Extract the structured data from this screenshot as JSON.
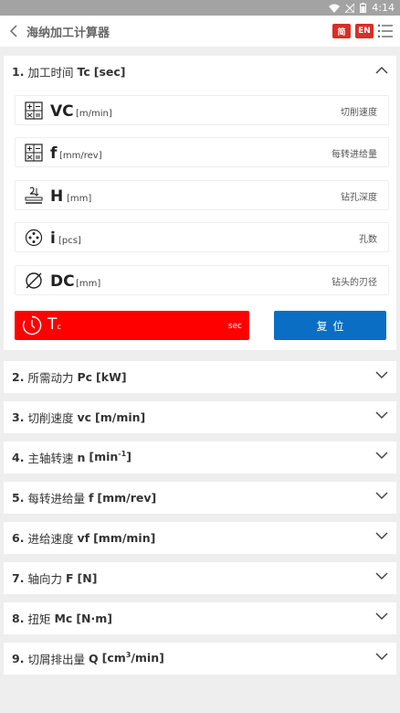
{
  "status": {
    "time": "4:14"
  },
  "header": {
    "title": "海纳加工计算器",
    "lang_cn": "简",
    "lang_en": "EN"
  },
  "sections": [
    {
      "num": "1.",
      "label": "加工时间",
      "symbol": "Tc",
      "unit": "[sec]",
      "expanded": true
    },
    {
      "num": "2.",
      "label": "所需动力",
      "symbol": "Pc",
      "unit": "[kW]"
    },
    {
      "num": "3.",
      "label": "切削速度",
      "symbol": "vc",
      "unit": "[m/min]"
    },
    {
      "num": "4.",
      "label": "主轴转速",
      "symbol": "n",
      "unit": "[min",
      "unit_sup": "-1",
      "unit_end": "]"
    },
    {
      "num": "5.",
      "label": "每转进给量",
      "symbol": "f",
      "unit": "[mm/rev]"
    },
    {
      "num": "6.",
      "label": "进给速度",
      "symbol": "vf",
      "unit": "[mm/min]"
    },
    {
      "num": "7.",
      "label": "轴向力",
      "symbol": "F",
      "unit": "[N]"
    },
    {
      "num": "8.",
      "label": "扭矩",
      "symbol": "Mc",
      "unit": "[N·m]"
    },
    {
      "num": "9.",
      "label": "切屑排出量",
      "symbol": "Q",
      "unit": "[cm",
      "unit_sup": "3",
      "unit_end": "/min]"
    }
  ],
  "fields": [
    {
      "symbol": "VC",
      "unit": "[m/min]",
      "desc": "切削速度",
      "icon": "calculator-icon"
    },
    {
      "symbol": "f",
      "unit": "[mm/rev]",
      "desc": "每转进给量",
      "icon": "calculator-icon"
    },
    {
      "symbol": "H",
      "unit": "[mm]",
      "desc": "钻孔深度",
      "icon": "drill-depth-icon"
    },
    {
      "symbol": "i",
      "unit": "[pcs]",
      "desc": "孔数",
      "icon": "holes-icon"
    },
    {
      "symbol": "DC",
      "unit": "[mm]",
      "desc": "钻头的刃径",
      "icon": "diameter-icon"
    }
  ],
  "result": {
    "label": "T",
    "sub": "c",
    "unit": "sec",
    "color": "#ff0000"
  },
  "reset_label": "复位",
  "colors": {
    "accent_blue": "#0a6ec4",
    "lang_red": "#d92e25"
  }
}
